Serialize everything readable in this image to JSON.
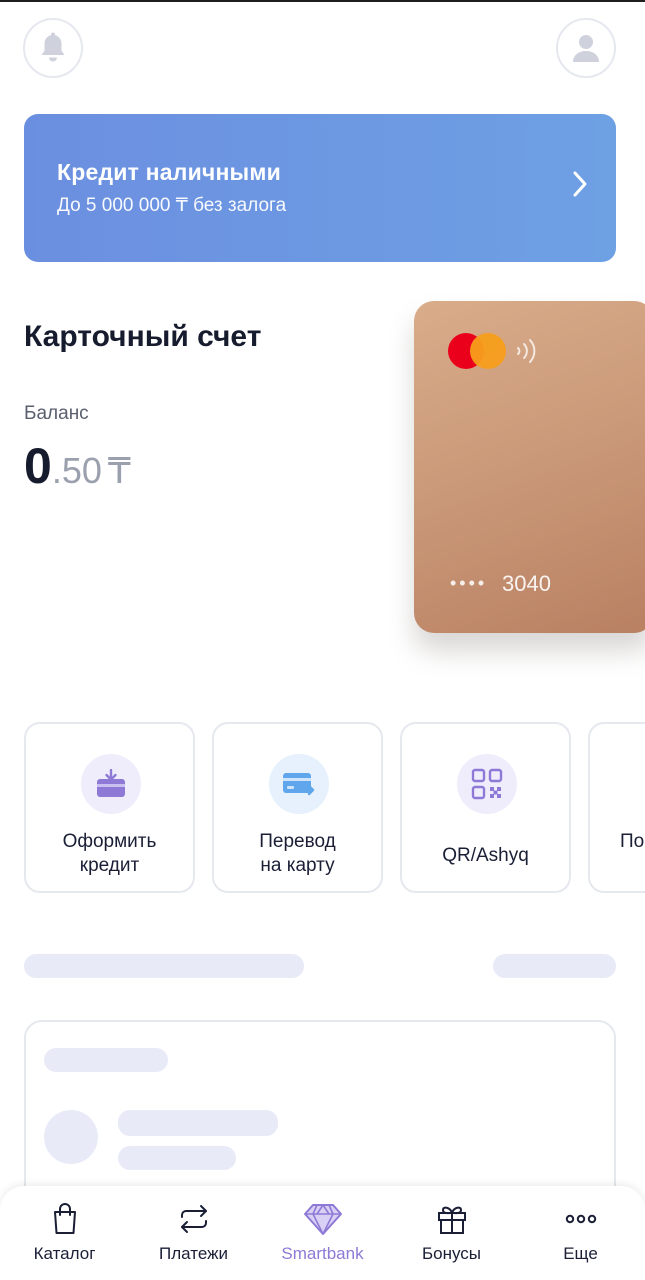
{
  "header": {
    "bell_icon": "bell-icon",
    "profile_icon": "user-icon"
  },
  "promo": {
    "title": "Кредит наличными",
    "subtitle": "До 5 000 000 ₸ без залога",
    "accent_color": "#6b8fe0"
  },
  "account": {
    "title": "Карточный счет",
    "balance_label": "Баланс",
    "balance_integer": "0",
    "balance_decimal": ".50",
    "currency": "₸"
  },
  "card": {
    "brand_icon": "mastercard-logo",
    "mask": "••••",
    "last_digits": "3040"
  },
  "actions": [
    {
      "line1": "Оформить",
      "line2": "кредит",
      "icon": "credit-icon"
    },
    {
      "line1": "Перевод",
      "line2": "на карту",
      "icon": "card-transfer-icon"
    },
    {
      "line1": "QR/Ashyq",
      "line2": "",
      "icon": "qr-icon"
    },
    {
      "line1": "По",
      "line2": "",
      "icon": ""
    }
  ],
  "tabbar": {
    "items": [
      {
        "label": "Каталог",
        "icon": "bag-icon"
      },
      {
        "label": "Платежи",
        "icon": "repeat-icon"
      },
      {
        "label": "Smartbank",
        "icon": "diamond-icon",
        "active": true
      },
      {
        "label": "Бонусы",
        "icon": "gift-icon"
      },
      {
        "label": "Еще",
        "icon": "more-icon"
      }
    ],
    "active_color": "#8e7ad6"
  }
}
